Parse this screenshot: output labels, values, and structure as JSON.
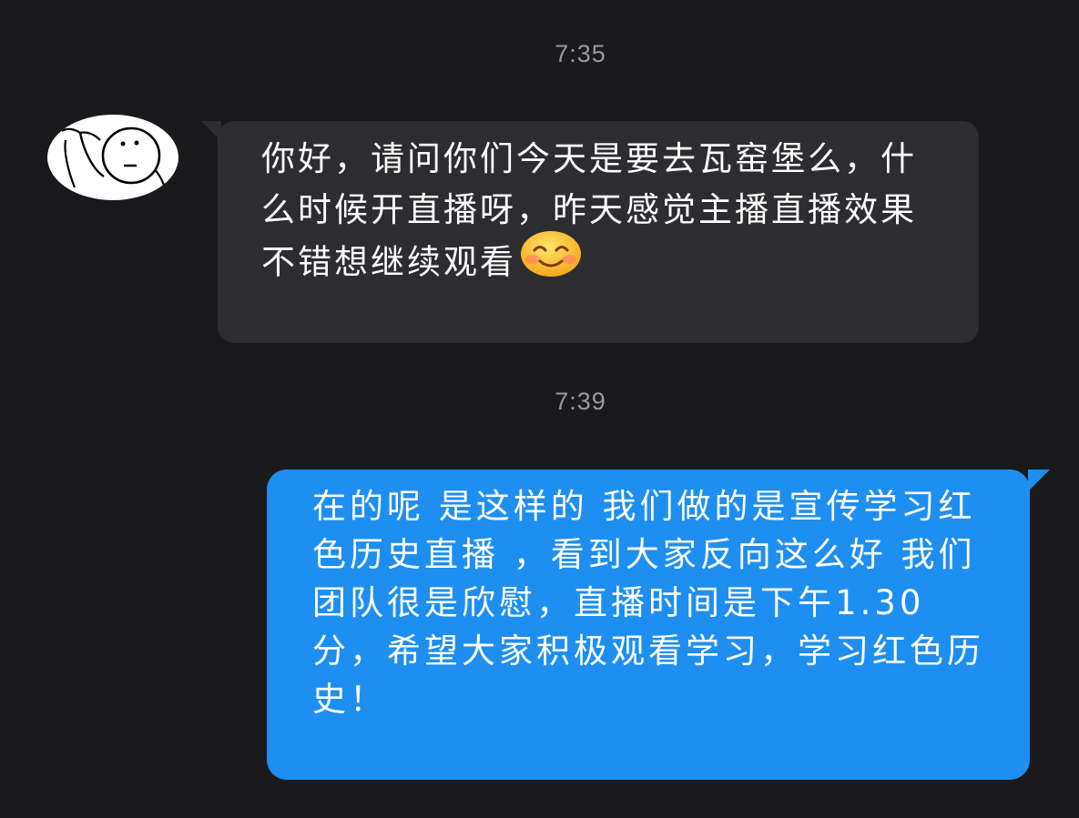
{
  "conversation": {
    "messages": [
      {
        "timestamp": "7:35",
        "direction": "incoming",
        "text": "你好，请问你们今天是要去瓦窑堡么，什么时候开直播呀，昨天感觉主播直播效果不错想继续观看",
        "emoji": "smiling-face-icon"
      },
      {
        "timestamp": "7:39",
        "direction": "outgoing",
        "text": "在的呢 是这样的 我们做的是宣传学习红色历史直播 ，看到大家反向这么好 我们团队很是欣慰，直播时间是下午1.30分，希望大家积极观看学习，学习红色历史！"
      }
    ]
  },
  "colors": {
    "background": "#1a1a1c",
    "incoming_bubble": "#2d2d31",
    "outgoing_bubble": "#1e8ff0",
    "timestamp_text": "#9a9a9e",
    "message_text": "#ffffff"
  }
}
